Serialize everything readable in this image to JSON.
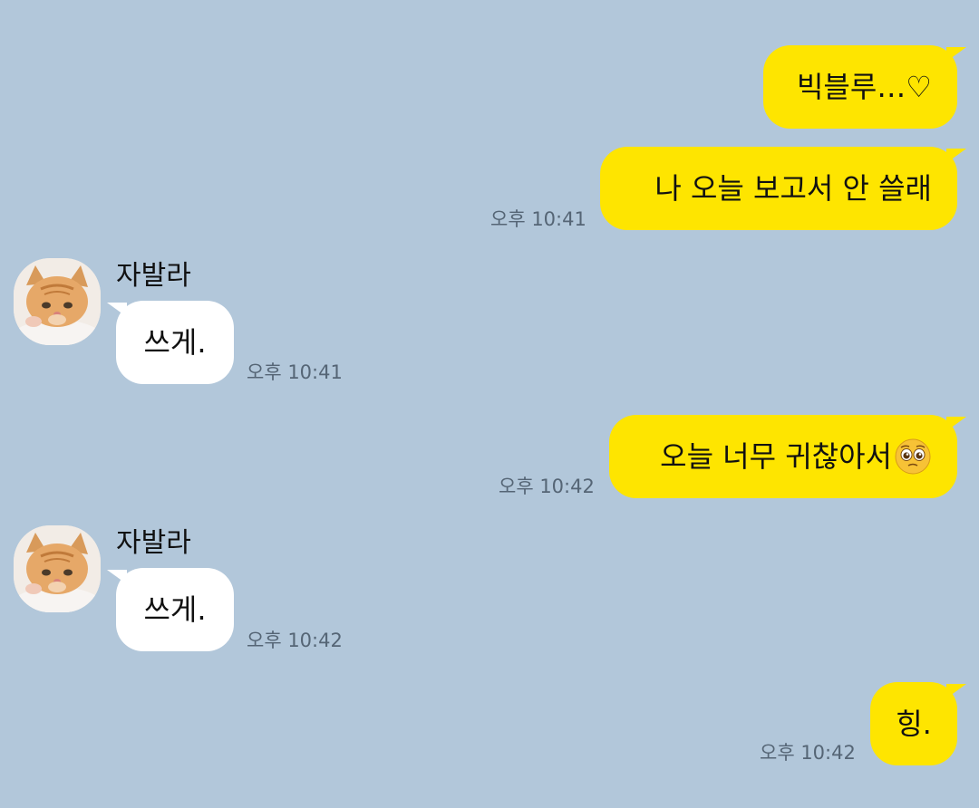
{
  "messages": [
    {
      "side": "me",
      "text": "빅블루…♡"
    },
    {
      "side": "me",
      "text": "나 오늘 보고서 안 쓸래",
      "time": "오후 10:41"
    },
    {
      "side": "other",
      "sender": "자발라",
      "text": "쓰게.",
      "time": "오후 10:41"
    },
    {
      "side": "me",
      "text": "오늘 너무 귀찮아서",
      "emoji": "pleading-face-icon",
      "time": "오후 10:42"
    },
    {
      "side": "other",
      "sender": "자발라",
      "text": "쓰게.",
      "time": "오후 10:42"
    },
    {
      "side": "me",
      "text": "힝.",
      "time": "오후 10:42"
    }
  ],
  "colors": {
    "background": "#b2c7da",
    "my_bubble": "#fee500",
    "other_bubble": "#ffffff",
    "timestamp": "#556575"
  }
}
